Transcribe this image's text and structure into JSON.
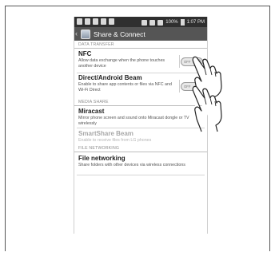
{
  "status_bar": {
    "battery": "100%",
    "time": "1:07 PM"
  },
  "action_bar": {
    "title": "Share & Connect"
  },
  "sections": {
    "data_transfer": "DATA TRANSFER",
    "media_share": "MEDIA SHARE",
    "file_networking": "FILE NETWORKING"
  },
  "items": {
    "nfc": {
      "title": "NFC",
      "subtitle": "Allow data exchange when the phone touches another device",
      "toggle": "OFF"
    },
    "beam": {
      "title": "Direct/Android Beam",
      "subtitle": "Enable to share app contents or files via NFC and Wi-Fi Direct",
      "toggle": "OFF"
    },
    "miracast": {
      "title": "Miracast",
      "subtitle": "Mirror phone screen and sound onto Miracast dongle or TV wirelessly"
    },
    "smartshare": {
      "title": "SmartShare Beam",
      "subtitle": "Enable to receive files from LG phones"
    },
    "file_networking": {
      "title": "File networking",
      "subtitle": "Share folders with other devices via wireless connections"
    }
  }
}
